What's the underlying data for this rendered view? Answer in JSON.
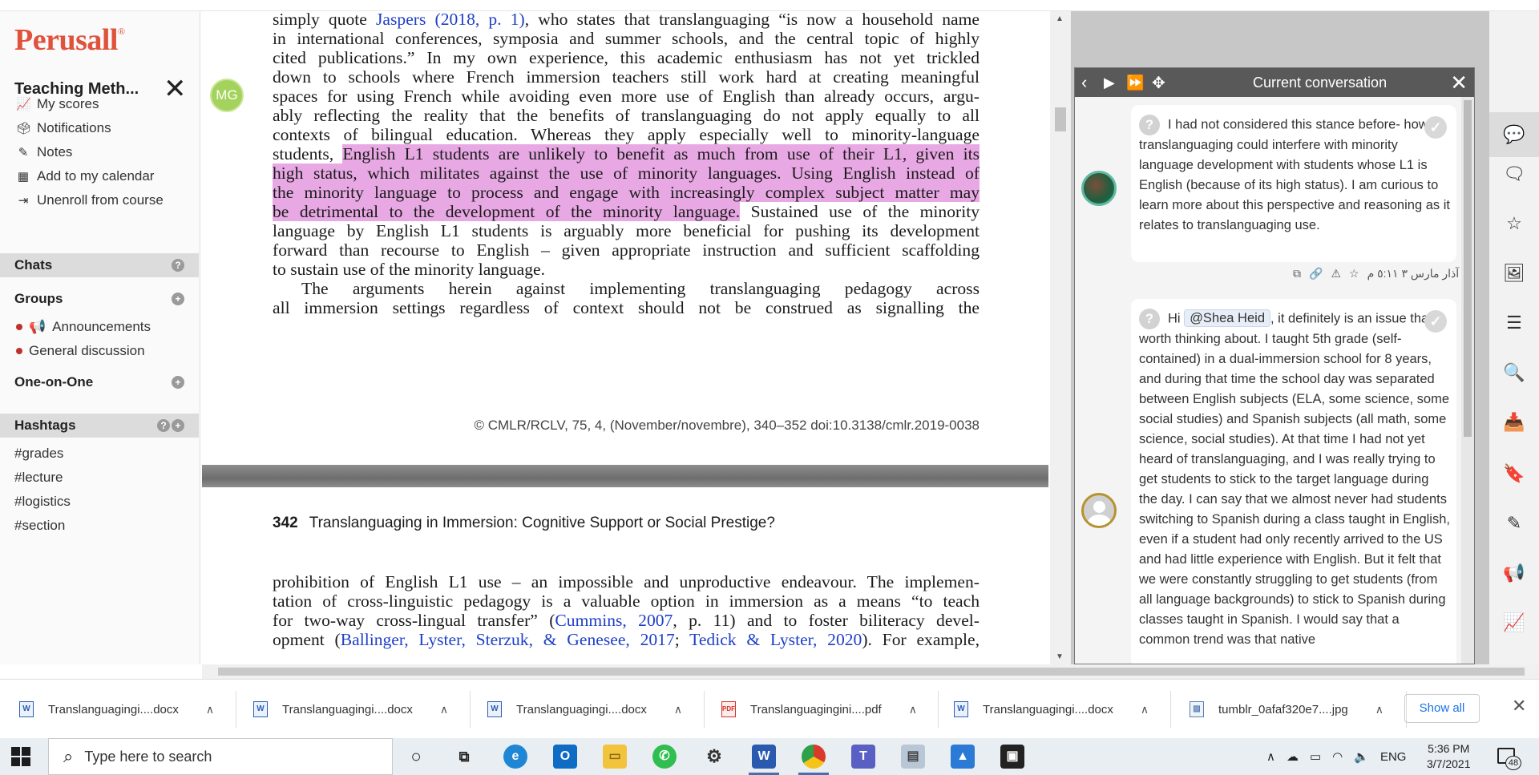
{
  "sidebar": {
    "logo": "Perusall",
    "logo_mark": "®",
    "course_title": "Teaching Meth...",
    "links": [
      {
        "icon": "chart-line-icon",
        "label": "My scores"
      },
      {
        "icon": "inbox-icon",
        "label": "Notifications"
      },
      {
        "icon": "pencil-icon",
        "label": "Notes"
      },
      {
        "icon": "calendar-icon",
        "label": "Add to my calendar"
      },
      {
        "icon": "sign-out-icon",
        "label": "Unenroll from course"
      }
    ],
    "chats": {
      "label": "Chats"
    },
    "groups": {
      "label": "Groups",
      "items": [
        {
          "icon": "megaphone-icon",
          "label": "Announcements"
        },
        {
          "label": "General discussion"
        }
      ]
    },
    "one_on_one": {
      "label": "One-on-One"
    },
    "hashtags": {
      "label": "Hashtags",
      "items": [
        "#grades",
        "#lecture",
        "#logistics",
        "#section"
      ]
    }
  },
  "document": {
    "avatar_initials": "MG",
    "page1_lines": [
      {
        "segments": [
          {
            "t": "simply quote "
          },
          {
            "t": "Jaspers (2018, p. 1)",
            "ref": true
          },
          {
            "t": ", who states that translanguaging “is now a household name"
          }
        ]
      },
      {
        "segments": [
          {
            "t": "in international conferences, symposia and summer schools, and the central topic of highly"
          }
        ]
      },
      {
        "segments": [
          {
            "t": "cited publications.” In my own experience, this academic enthusiasm has not yet trickled"
          }
        ]
      },
      {
        "segments": [
          {
            "t": "down to schools where French immersion teachers still work hard at creating meaningful"
          }
        ]
      },
      {
        "segments": [
          {
            "t": "spaces for using French while avoiding even more use of English than already occurs, argu-"
          }
        ]
      },
      {
        "segments": [
          {
            "t": "ably reflecting the reality that the benefits of translanguaging do not apply equally to all"
          }
        ]
      },
      {
        "segments": [
          {
            "t": "contexts of bilingual education. Whereas they apply especially well to minority-language"
          }
        ]
      },
      {
        "segments": [
          {
            "t": "students, "
          },
          {
            "t": "English L1 students are unlikely to benefit as much from use of their L1, given its",
            "hl": true
          }
        ]
      },
      {
        "segments": [
          {
            "t": "high status, which militates against the use of minority languages. Using English instead of",
            "hl": true
          }
        ]
      },
      {
        "segments": [
          {
            "t": "the minority language to process and engage with increasingly complex subject matter may",
            "hl": true
          }
        ]
      },
      {
        "segments": [
          {
            "t": "be detrimental to the development of the minority language.",
            "hl": true
          },
          {
            "t": " Sustained use of the minority"
          }
        ]
      },
      {
        "segments": [
          {
            "t": "language by English L1 students is arguably more beneficial for pushing its development"
          }
        ]
      },
      {
        "segments": [
          {
            "t": "forward than recourse to English – given appropriate instruction and sufficient scaffolding"
          }
        ]
      },
      {
        "segments": [
          {
            "t": "to sustain use of the minority language."
          }
        ],
        "last": true
      },
      {
        "segments": [
          {
            "t": "The arguments herein against implementing translanguaging pedagogy across"
          }
        ],
        "indent": true
      },
      {
        "segments": [
          {
            "t": "all immersion settings regardless of context should not be construed as signalling the"
          }
        ]
      }
    ],
    "footer_citation": "© CMLR/RCLV, 75, 4, (November/novembre), 340–352   doi:10.3138/cmlr.2019-0038",
    "page2_number": "342",
    "page2_title": "Translanguaging in Immersion: Cognitive Support or Social Prestige?",
    "page2_lines": [
      {
        "segments": [
          {
            "t": "prohibition of English L1 use – an impossible and unproductive endeavour. The implemen-"
          }
        ]
      },
      {
        "segments": [
          {
            "t": "tation of cross-linguistic pedagogy is a valuable option in immersion as a means “to teach"
          }
        ]
      },
      {
        "segments": [
          {
            "t": "for two-way cross-lingual transfer” ("
          },
          {
            "t": "Cummins, 2007",
            "ref": true
          },
          {
            "t": ", p. 11) and to foster biliteracy devel-"
          }
        ]
      },
      {
        "segments": [
          {
            "t": "opment ("
          },
          {
            "t": "Ballinger, Lyster, Sterzuk, & Genesee, 2017",
            "ref": true
          },
          {
            "t": "; "
          },
          {
            "t": "Tedick & Lyster, 2020",
            "ref": true
          },
          {
            "t": "). For example,"
          }
        ]
      }
    ]
  },
  "conversation": {
    "title": "Current conversation",
    "comments": [
      {
        "text": "I had not considered this stance before- how translanguaging could interfere with minority language development with students whose L1 is English (because of its high status). I am curious to learn more about this perspective and reasoning as it relates to translanguaging use.",
        "timestamp": "آذار مارس ٣ ٥:١١ م"
      },
      {
        "greeting": "Hi",
        "mention": "@Shea Heid",
        "text": ", it definitely is an issue that is worth thinking about. I taught 5th grade (self-contained) in a dual-immersion school for 8 years, and during that time the school day was separated between English subjects (ELA, some science, some social studies) and Spanish subjects (all math, some science, social studies). At that time I had not yet heard of translanguaging, and I was really trying to get students to stick to the target language during the day. I can say that we almost never had students switching to Spanish during a class taught in English, even if a student had only recently arrived to the US and had little experience with English. But it felt that we were constantly struggling to get students (from all language backgrounds) to stick to Spanish during classes taught in Spanish. I would say that a common trend was that native"
      }
    ]
  },
  "downloads": {
    "items": [
      {
        "name": "Translanguagingi....docx",
        "type": "docx"
      },
      {
        "name": "Translanguagingi....docx",
        "type": "docx"
      },
      {
        "name": "Translanguagingi....docx",
        "type": "docx"
      },
      {
        "name": "Translanguagingini....pdf",
        "type": "pdf"
      },
      {
        "name": "Translanguagingi....docx",
        "type": "docx"
      },
      {
        "name": "tumblr_0afaf320e7....jpg",
        "type": "jpg"
      }
    ],
    "show_all": "Show all"
  },
  "taskbar": {
    "search_placeholder": "Type here to search",
    "lang": "ENG",
    "time": "5:36 PM",
    "date": "3/7/2021",
    "notification_count": "48"
  }
}
